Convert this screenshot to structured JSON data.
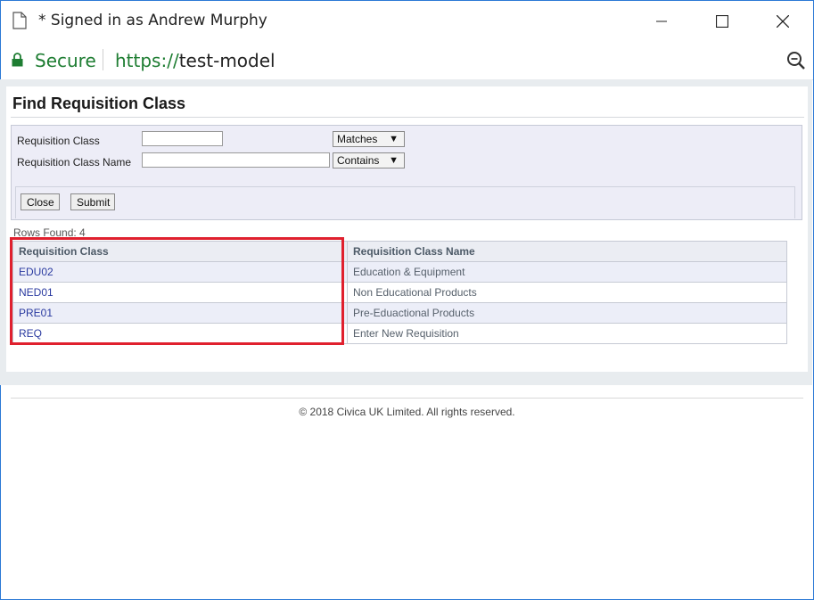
{
  "window": {
    "title": "* Signed in as Andrew Murphy"
  },
  "address_bar": {
    "secure_label": "Secure",
    "url_scheme": "https://",
    "url_host": "test-model"
  },
  "page": {
    "title": "Find Requisition Class",
    "form": {
      "class_label": "Requisition Class",
      "class_value": "",
      "class_match": "Matches",
      "name_label": "Requisition Class Name",
      "name_value": "",
      "name_match": "Contains",
      "close_label": "Close",
      "submit_label": "Submit"
    },
    "rows_found": "Rows Found: 4",
    "table": {
      "headers": [
        "Requisition Class",
        "Requisition Class Name"
      ],
      "rows": [
        [
          "EDU02",
          "Education & Equipment"
        ],
        [
          "NED01",
          "Non Educational Products"
        ],
        [
          "PRE01",
          "Pre-Eduactional Products"
        ],
        [
          "REQ",
          "Enter New Requisition"
        ]
      ]
    },
    "footer": "© 2018 Civica UK Limited. All rights reserved."
  },
  "colors": {
    "highlight": "#e0202e",
    "secure_green": "#1e7d32",
    "link": "#2a3aa0"
  },
  "icons": [
    "document-icon",
    "minimize-icon",
    "maximize-icon",
    "close-icon",
    "lock-icon",
    "zoom-out-icon"
  ]
}
